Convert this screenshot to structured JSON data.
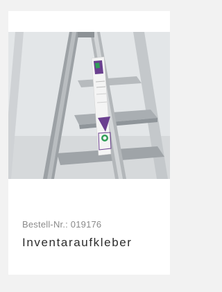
{
  "product": {
    "order_number": "Bestell-Nr.: 019176",
    "title": "Inventaraufkleber",
    "image_subject": "ladder-with-inventory-labels"
  },
  "colors": {
    "page_background": "#f2f2f2",
    "card_background": "#ffffff",
    "order_number_text": "#8a8a8a",
    "title_text": "#2b2b2b",
    "label_purple": "#6a3f8f",
    "label_green": "#2f9e57"
  }
}
